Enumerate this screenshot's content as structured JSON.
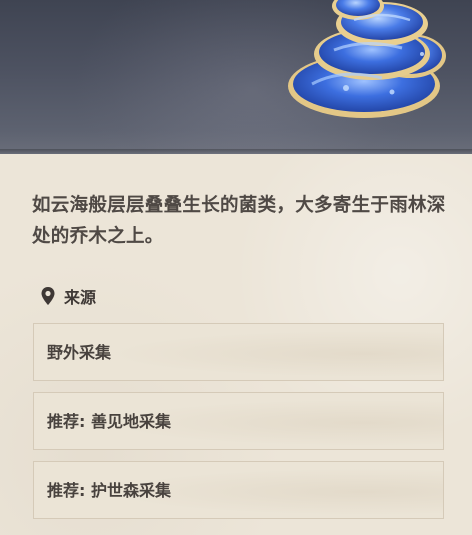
{
  "item": {
    "image_icon": "blue-layered-mushroom-icon",
    "description": "如云海般层层叠叠生长的菌类，大多寄生于雨林深处的乔木之上。"
  },
  "source": {
    "icon": "location-pin-icon",
    "title": "来源",
    "items": [
      {
        "label": "野外采集"
      },
      {
        "label": "推荐: 善见地采集"
      },
      {
        "label": "推荐: 护世森采集"
      }
    ]
  },
  "colors": {
    "header_bg": "#4d5261",
    "panel_bg": "#ece5d8",
    "row_border": "#d5cab8",
    "mushroom_blue": "#2f5fd6",
    "mushroom_rim": "#e6c98a",
    "text_primary": "#4f4945"
  }
}
